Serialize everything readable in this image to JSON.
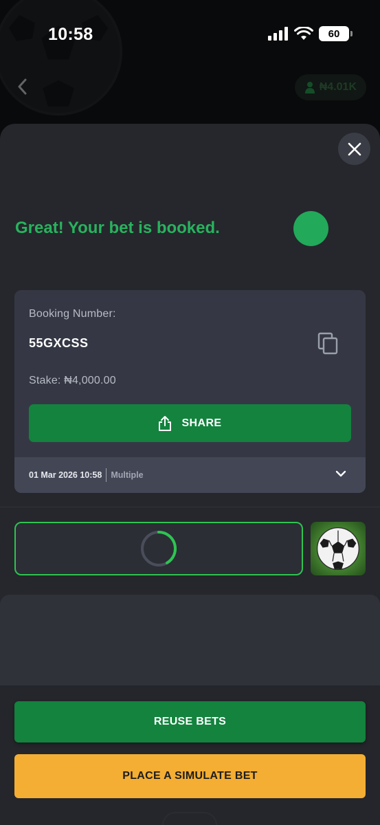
{
  "status_bar": {
    "time": "10:58",
    "battery": "60",
    "icons": [
      "signal-icon",
      "wifi-icon",
      "battery-icon"
    ]
  },
  "header": {
    "back_icon": "chevron-left-icon",
    "balance": "₦4.01K",
    "balance_icon": "person-icon"
  },
  "sheet": {
    "close_icon": "close-icon",
    "success_message": "Great! Your bet is booked.",
    "booking": {
      "label": "Booking Number:",
      "code": "55GXCSS",
      "copy_icon": "copy-icon",
      "stake": "Stake: ₦4,000.00",
      "share_label": "SHARE",
      "share_icon": "share-icon",
      "date": "01 Mar 2026 10:58",
      "bet_type": "Multiple",
      "expand_icon": "chevron-down-icon"
    },
    "loading": {
      "spinner_icon": "loading-spinner-icon",
      "thumbnail_icon": "soccer-ball-icon"
    }
  },
  "actions": {
    "reuse_label": "REUSE BETS",
    "simulate_label": "PLACE A SIMULATE BET"
  },
  "colors": {
    "accent_green": "#13833e",
    "success_green": "#28b35e",
    "simulate_orange": "#f4ae33",
    "sheet_bg": "#25272c",
    "card_bg": "#353844"
  }
}
